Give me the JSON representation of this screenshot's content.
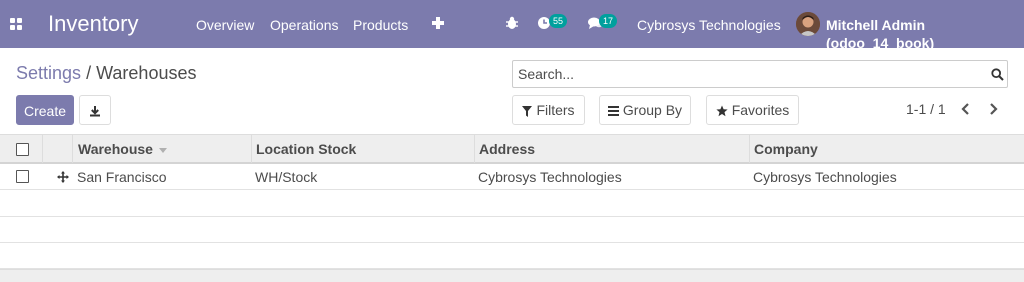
{
  "navbar": {
    "app_name": "Inventory",
    "menu": [
      "Overview",
      "Operations",
      "Products"
    ],
    "activity_count": "55",
    "message_count": "17",
    "company": "Cybrosys Technologies",
    "user": "Mitchell Admin (odoo_14_book)",
    "color": "#7c7bad",
    "icons": [
      "apps-icon",
      "plus-icon",
      "bug-icon",
      "activity-clock-icon",
      "chat-bubbles-icon"
    ]
  },
  "breadcrumb": {
    "parent": "Settings",
    "separator": "/",
    "current": "Warehouses"
  },
  "search": {
    "placeholder": "Search..."
  },
  "buttons": {
    "create": "Create",
    "filters": "Filters",
    "group_by": "Group By",
    "favorites": "Favorites"
  },
  "pager": {
    "value": "1-1 / 1"
  },
  "table": {
    "columns": [
      "Warehouse",
      "Location Stock",
      "Address",
      "Company"
    ],
    "rows": [
      {
        "warehouse": "San Francisco",
        "location_stock": "WH/Stock",
        "address": "Cybrosys Technologies",
        "company": "Cybrosys Technologies"
      }
    ]
  }
}
